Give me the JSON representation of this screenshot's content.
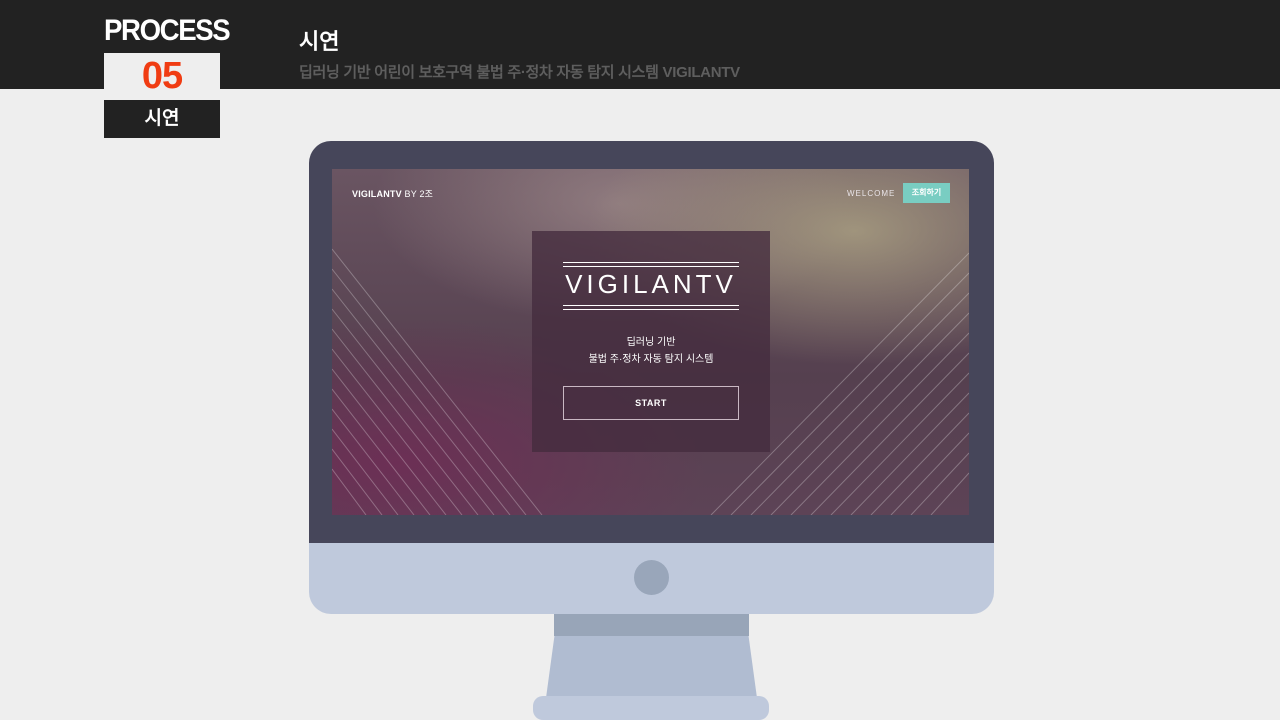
{
  "process": {
    "label": "PROCESS",
    "number": "05",
    "tag": "시연"
  },
  "header": {
    "title": "시연",
    "subtitle": "딥러닝 기반 어린이 보호구역 불법 주·정차 자동 탐지 시스템 VIGILANTV"
  },
  "screen": {
    "brand": "VIGILANTV",
    "brand_by": "BY 2조",
    "welcome": "WELCOME",
    "lookup_button": "조회하기",
    "logo": "VIGILANTV",
    "tagline_1": "딥러닝 기반",
    "tagline_2": "불법 주·정차 자동 탐지 시스템",
    "start_button": "START"
  },
  "colors": {
    "accent": "#f03c12",
    "topbar": "#222222",
    "button": "#79cdc2"
  }
}
